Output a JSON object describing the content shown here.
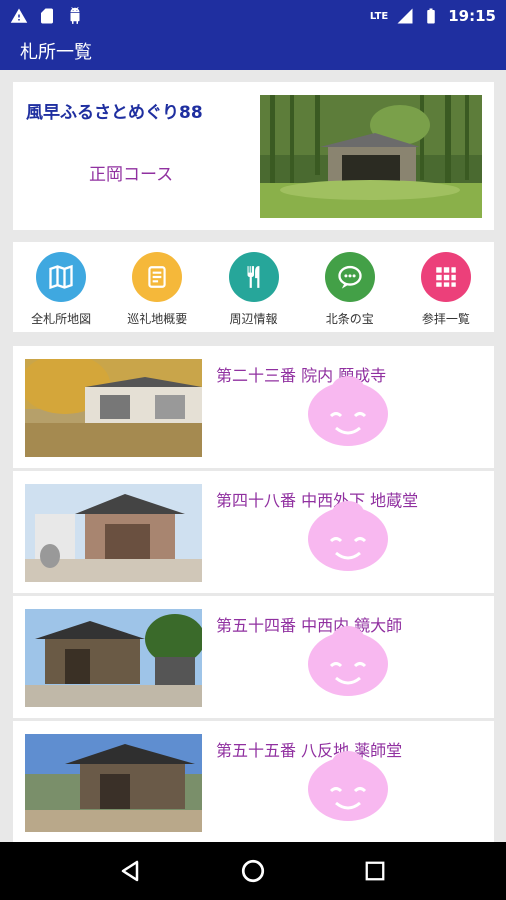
{
  "status": {
    "time": "19:15",
    "network": "LTE"
  },
  "appbar": {
    "title": "札所一覧"
  },
  "hero": {
    "title": "風早ふるさとめぐり88",
    "course": "正岡コース"
  },
  "menu": [
    {
      "label": "全札所地図",
      "icon": "map-icon",
      "color": "#3fa8e0"
    },
    {
      "label": "巡礼地概要",
      "icon": "document-icon",
      "color": "#f5b83a"
    },
    {
      "label": "周辺情報",
      "icon": "restaurant-icon",
      "color": "#26a69a"
    },
    {
      "label": "北条の宝",
      "icon": "chat-icon",
      "color": "#43a047"
    },
    {
      "label": "参拝一覧",
      "icon": "grid-icon",
      "color": "#ec407a"
    }
  ],
  "list": [
    {
      "title": "第二十三番 院内 願成寺"
    },
    {
      "title": "第四十八番 中西外下 地蔵堂"
    },
    {
      "title": "第五十四番 中西内 鏡大師"
    },
    {
      "title": "第五十五番 八反地 薬師堂"
    }
  ],
  "colors": {
    "primary": "#1f2fa0",
    "accent": "#9030a0",
    "buddha": "#f8b8f0"
  }
}
